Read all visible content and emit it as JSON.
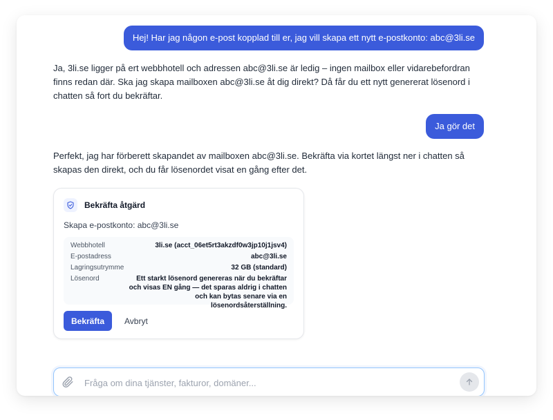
{
  "chat": {
    "user_message_1": "Hej! Har jag någon e-post kopplad till er, jag vill skapa ett nytt e-postkonto: abc@3li.se",
    "assistant_message_1": "Ja, 3li.se ligger på ert webbhotell och adressen abc@3li.se är ledig – ingen mailbox eller vidarebefordran finns redan där. Ska jag skapa mailboxen abc@3li.se åt dig direkt? Då får du ett nytt genererat lösenord i chatten så fort du bekräftar.",
    "user_message_2": "Ja gör det",
    "assistant_message_2": "Perfekt, jag har förberett skapandet av mailboxen abc@3li.se. Bekräfta via kortet längst ner i chatten så skapas den direkt, och du får lösenordet visat en gång efter det."
  },
  "confirm_card": {
    "icon": "shield-check-icon",
    "title": "Bekräfta åtgärd",
    "subtitle": "Skapa e-postkonto: abc@3li.se",
    "details": [
      {
        "label": "Webbhotell",
        "value": "3li.se (acct_06et5rt3akzdf0w3jp10j1jsv4)"
      },
      {
        "label": "E-postadress",
        "value": "abc@3li.se"
      },
      {
        "label": "Lagringsutrymme",
        "value": "32 GB (standard)"
      },
      {
        "label": "Lösenord",
        "value": "Ett starkt lösenord genereras när du bekräftar och visas EN gång — det sparas aldrig i chatten och kan bytas senare via en lösenordsåterställning."
      }
    ],
    "confirm_label": "Bekräfta",
    "cancel_label": "Avbryt"
  },
  "composer": {
    "placeholder": "Fråga om dina tjänster, fakturor, domäner...",
    "value": "",
    "attach_icon": "paperclip-icon",
    "send_icon": "arrow-up-icon"
  },
  "colors": {
    "accent": "#3b5bdb",
    "focus_border": "#93c5fd"
  }
}
